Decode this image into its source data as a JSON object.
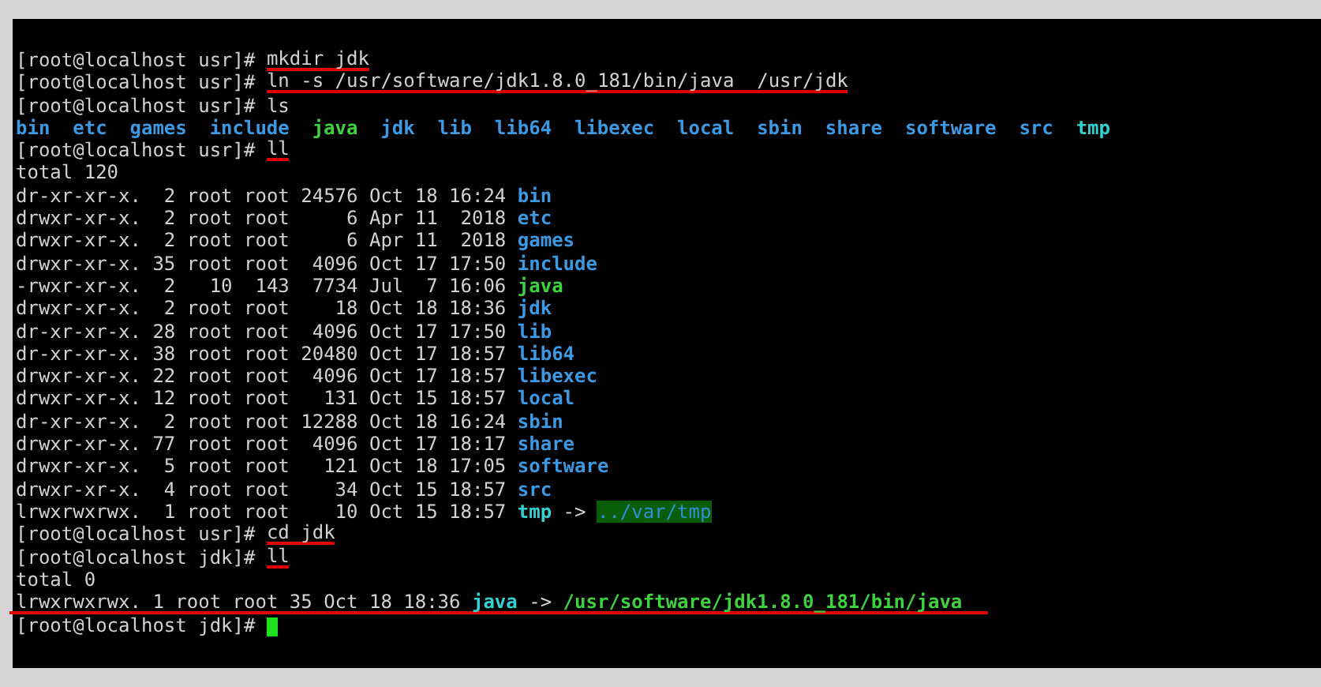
{
  "terminal": {
    "lines": [
      {
        "segments": [
          {
            "kind": "prompt",
            "text": "[root@localhost usr]# "
          },
          {
            "kind": "command",
            "text": "mkdir jdk",
            "marked": true
          }
        ]
      },
      {
        "segments": [
          {
            "kind": "prompt",
            "text": "[root@localhost usr]# "
          },
          {
            "kind": "command",
            "text": "ln -s /usr/software/jdk1.8.0_181/bin/java  /usr/jdk",
            "marked": true
          }
        ]
      },
      {
        "segments": [
          {
            "kind": "prompt",
            "text": "[root@localhost usr]# "
          },
          {
            "kind": "command",
            "text": "ls",
            "marked": false
          }
        ]
      },
      {
        "kind": "listing",
        "segments": [
          {
            "kind": "dir",
            "text": "bin"
          },
          {
            "kind": "dir",
            "text": "etc"
          },
          {
            "kind": "dir",
            "text": "games"
          },
          {
            "kind": "dir",
            "text": "include"
          },
          {
            "kind": "exec",
            "text": "java"
          },
          {
            "kind": "dir",
            "text": "jdk"
          },
          {
            "kind": "dir",
            "text": "lib"
          },
          {
            "kind": "dir",
            "text": "lib64"
          },
          {
            "kind": "dir",
            "text": "libexec"
          },
          {
            "kind": "dir",
            "text": "local"
          },
          {
            "kind": "dir",
            "text": "sbin"
          },
          {
            "kind": "dir",
            "text": "share"
          },
          {
            "kind": "dir",
            "text": "software"
          },
          {
            "kind": "dir",
            "text": "src"
          },
          {
            "kind": "link",
            "text": "tmp"
          }
        ]
      },
      {
        "segments": [
          {
            "kind": "prompt",
            "text": "[root@localhost usr]# "
          },
          {
            "kind": "command",
            "text": "ll",
            "marked": true
          }
        ]
      },
      {
        "segments": [
          {
            "kind": "plain",
            "text": "total 120"
          }
        ]
      },
      {
        "segments": [
          {
            "kind": "plain",
            "text": "dr-xr-xr-x.  2 root root 24576 Oct 18 16:24 "
          },
          {
            "kind": "dir",
            "text": "bin"
          }
        ]
      },
      {
        "segments": [
          {
            "kind": "plain",
            "text": "drwxr-xr-x.  2 root root     6 Apr 11  2018 "
          },
          {
            "kind": "dir",
            "text": "etc"
          }
        ]
      },
      {
        "segments": [
          {
            "kind": "plain",
            "text": "drwxr-xr-x.  2 root root     6 Apr 11  2018 "
          },
          {
            "kind": "dir",
            "text": "games"
          }
        ]
      },
      {
        "segments": [
          {
            "kind": "plain",
            "text": "drwxr-xr-x. 35 root root  4096 Oct 17 17:50 "
          },
          {
            "kind": "dir",
            "text": "include"
          }
        ]
      },
      {
        "segments": [
          {
            "kind": "plain",
            "text": "-rwxr-xr-x.  2   10  143  7734 Jul  7 16:06 "
          },
          {
            "kind": "exec",
            "text": "java"
          }
        ]
      },
      {
        "segments": [
          {
            "kind": "plain",
            "text": "drwxr-xr-x.  2 root root    18 Oct 18 18:36 "
          },
          {
            "kind": "dir",
            "text": "jdk"
          }
        ]
      },
      {
        "segments": [
          {
            "kind": "plain",
            "text": "dr-xr-xr-x. 28 root root  4096 Oct 17 17:50 "
          },
          {
            "kind": "dir",
            "text": "lib"
          }
        ]
      },
      {
        "segments": [
          {
            "kind": "plain",
            "text": "dr-xr-xr-x. 38 root root 20480 Oct 17 18:57 "
          },
          {
            "kind": "dir",
            "text": "lib64"
          }
        ]
      },
      {
        "segments": [
          {
            "kind": "plain",
            "text": "drwxr-xr-x. 22 root root  4096 Oct 17 18:57 "
          },
          {
            "kind": "dir",
            "text": "libexec"
          }
        ]
      },
      {
        "segments": [
          {
            "kind": "plain",
            "text": "drwxr-xr-x. 12 root root   131 Oct 15 18:57 "
          },
          {
            "kind": "dir",
            "text": "local"
          }
        ]
      },
      {
        "segments": [
          {
            "kind": "plain",
            "text": "dr-xr-xr-x.  2 root root 12288 Oct 18 16:24 "
          },
          {
            "kind": "dir",
            "text": "sbin"
          }
        ]
      },
      {
        "segments": [
          {
            "kind": "plain",
            "text": "drwxr-xr-x. 77 root root  4096 Oct 17 18:17 "
          },
          {
            "kind": "dir",
            "text": "share"
          }
        ]
      },
      {
        "segments": [
          {
            "kind": "plain",
            "text": "drwxr-xr-x.  5 root root   121 Oct 18 17:05 "
          },
          {
            "kind": "dir",
            "text": "software"
          }
        ]
      },
      {
        "segments": [
          {
            "kind": "plain",
            "text": "drwxr-xr-x.  4 root root    34 Oct 15 18:57 "
          },
          {
            "kind": "dir",
            "text": "src"
          }
        ]
      },
      {
        "segments": [
          {
            "kind": "plain",
            "text": "lrwxrwxrwx.  1 root root    10 Oct 15 18:57 "
          },
          {
            "kind": "link",
            "text": "tmp"
          },
          {
            "kind": "arrow",
            "text": " -> "
          },
          {
            "kind": "broken_target",
            "text": "../var/tmp"
          }
        ]
      },
      {
        "segments": [
          {
            "kind": "prompt",
            "text": "[root@localhost usr]# "
          },
          {
            "kind": "command",
            "text": "cd jdk",
            "marked": true
          }
        ]
      },
      {
        "segments": [
          {
            "kind": "prompt",
            "text": "[root@localhost jdk]# "
          },
          {
            "kind": "command",
            "text": "ll",
            "marked": true
          }
        ]
      },
      {
        "segments": [
          {
            "kind": "plain",
            "text": "total 0"
          }
        ]
      },
      {
        "marked": true,
        "segments": [
          {
            "kind": "plain",
            "text": "lrwxrwxrwx. 1 root root 35 Oct 18 18:36 "
          },
          {
            "kind": "link",
            "text": "java"
          },
          {
            "kind": "arrow",
            "text": " -> "
          },
          {
            "kind": "exec",
            "text": "/usr/software/jdk1.8.0_181/bin/java"
          }
        ]
      },
      {
        "cursor": true,
        "segments": [
          {
            "kind": "prompt",
            "text": "[root@localhost jdk]# "
          }
        ]
      }
    ]
  }
}
